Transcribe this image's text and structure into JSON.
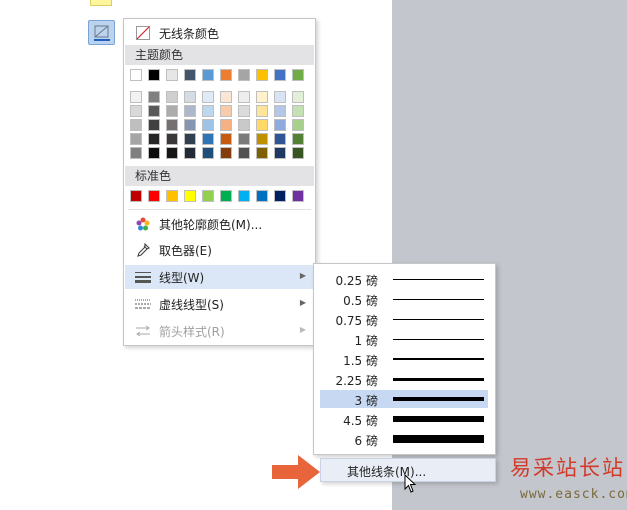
{
  "menu": {
    "no_line": "无线条颜色",
    "theme_colors_header": "主题颜色",
    "standard_colors_header": "标准色",
    "more_colors": "其他轮廓颜色(M)...",
    "eyedropper": "取色器(E)",
    "line_style": "线型(W)",
    "dash_style": "虚线线型(S)",
    "arrow_style": "箭头样式(R)"
  },
  "theme_colors": {
    "top": [
      "#ffffff",
      "#000000",
      "#e7e6e6",
      "#44546a",
      "#5b9bd5",
      "#ed7d31",
      "#a5a5a5",
      "#ffc000",
      "#4472c4",
      "#70ad47"
    ],
    "shades": [
      [
        "#f2f2f2",
        "#808080",
        "#d0cece",
        "#d6dce4",
        "#deebf6",
        "#fbe5d5",
        "#ededed",
        "#fff2cc",
        "#dae3f3",
        "#e2efd9"
      ],
      [
        "#d9d9d9",
        "#595959",
        "#aeabab",
        "#adb9ca",
        "#bdd7ee",
        "#f8cbad",
        "#dbdbdb",
        "#fee599",
        "#b4c7e7",
        "#c5e0b3"
      ],
      [
        "#bfbfbf",
        "#404040",
        "#757171",
        "#8496b0",
        "#9dc3e6",
        "#f4b183",
        "#c9c9c9",
        "#ffd965",
        "#8faadc",
        "#a8d08d"
      ],
      [
        "#a6a6a6",
        "#262626",
        "#3a3838",
        "#323f4f",
        "#2e75b5",
        "#c55a11",
        "#7b7b7b",
        "#bf9000",
        "#2f5597",
        "#538135"
      ],
      [
        "#808080",
        "#0d0d0d",
        "#161616",
        "#222a35",
        "#1f4e79",
        "#833c0b",
        "#525252",
        "#7f6000",
        "#1f3864",
        "#375623"
      ]
    ]
  },
  "standard_colors": [
    "#c00000",
    "#ff0000",
    "#ffc000",
    "#ffff00",
    "#92d050",
    "#00b050",
    "#00b0f0",
    "#0070c0",
    "#002060",
    "#7030a0"
  ],
  "line_weights": [
    {
      "label": "0.25 磅",
      "value": 0.25
    },
    {
      "label": "0.5 磅",
      "value": 0.5
    },
    {
      "label": "0.75 磅",
      "value": 0.75
    },
    {
      "label": "1 磅",
      "value": 1
    },
    {
      "label": "1.5 磅",
      "value": 1.5
    },
    {
      "label": "2.25 磅",
      "value": 2.25
    },
    {
      "label": "3 磅",
      "value": 3
    },
    {
      "label": "4.5 磅",
      "value": 4.5
    },
    {
      "label": "6 磅",
      "value": 6
    }
  ],
  "selected_weight": "3 磅",
  "more_lines": "其他线条(M)...",
  "watermark": {
    "line1": "易采站长站",
    "line2": "www.easck.com"
  }
}
